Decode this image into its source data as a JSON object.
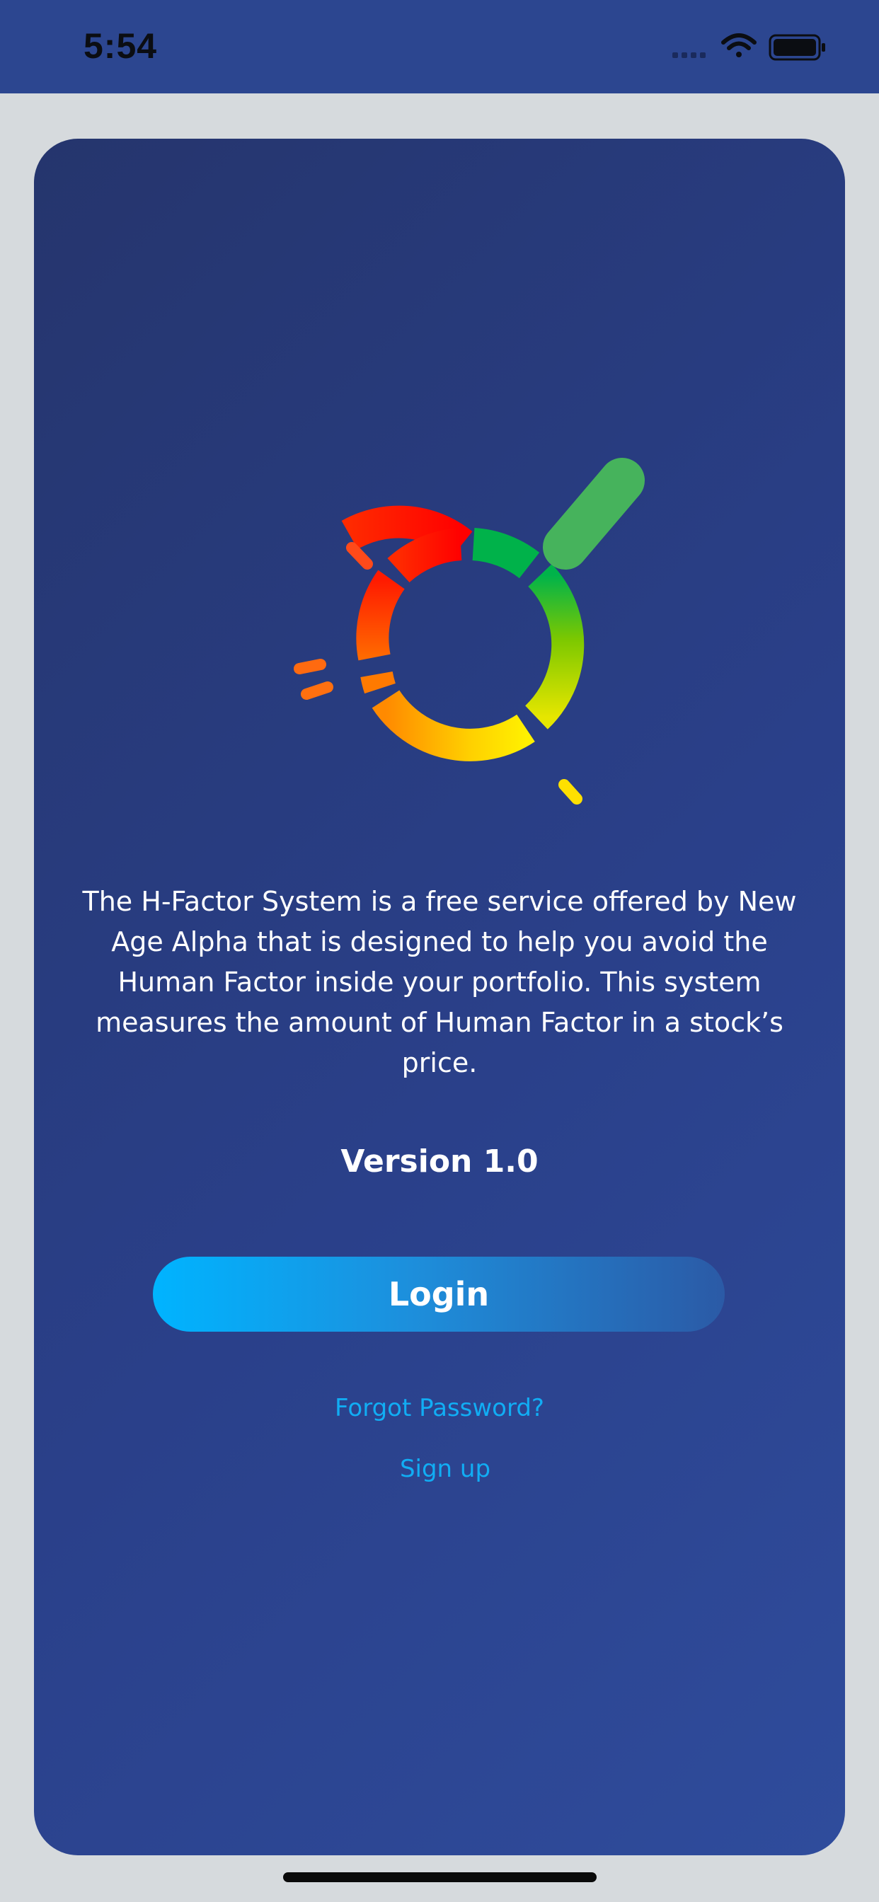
{
  "status_bar": {
    "time": "5:54",
    "icons": [
      "signal-icon",
      "wifi-icon",
      "battery-icon"
    ],
    "background_color": "#2c4690"
  },
  "card": {
    "logo": {
      "name": "h-factor-logo",
      "colors": [
        "#ff0000",
        "#ff6a00",
        "#ffe600",
        "#a6d400",
        "#00b34a",
        "#46b35c"
      ]
    },
    "description": "The H-Factor System is a free service offered by New Age Alpha that is designed to help you avoid the Human Factor inside your portfolio. This system measures the amount of Human Factor in a stock’s price.",
    "version": "Version 1.0",
    "login_label": "Login",
    "forgot_password_label": "Forgot Password?",
    "sign_up_label": "Sign up"
  },
  "colors": {
    "link": "#11adf4",
    "button_start": "#00b4ff",
    "button_end": "#2b5aa6",
    "card_background": "#2a408a",
    "page_background": "#d6dadd"
  }
}
